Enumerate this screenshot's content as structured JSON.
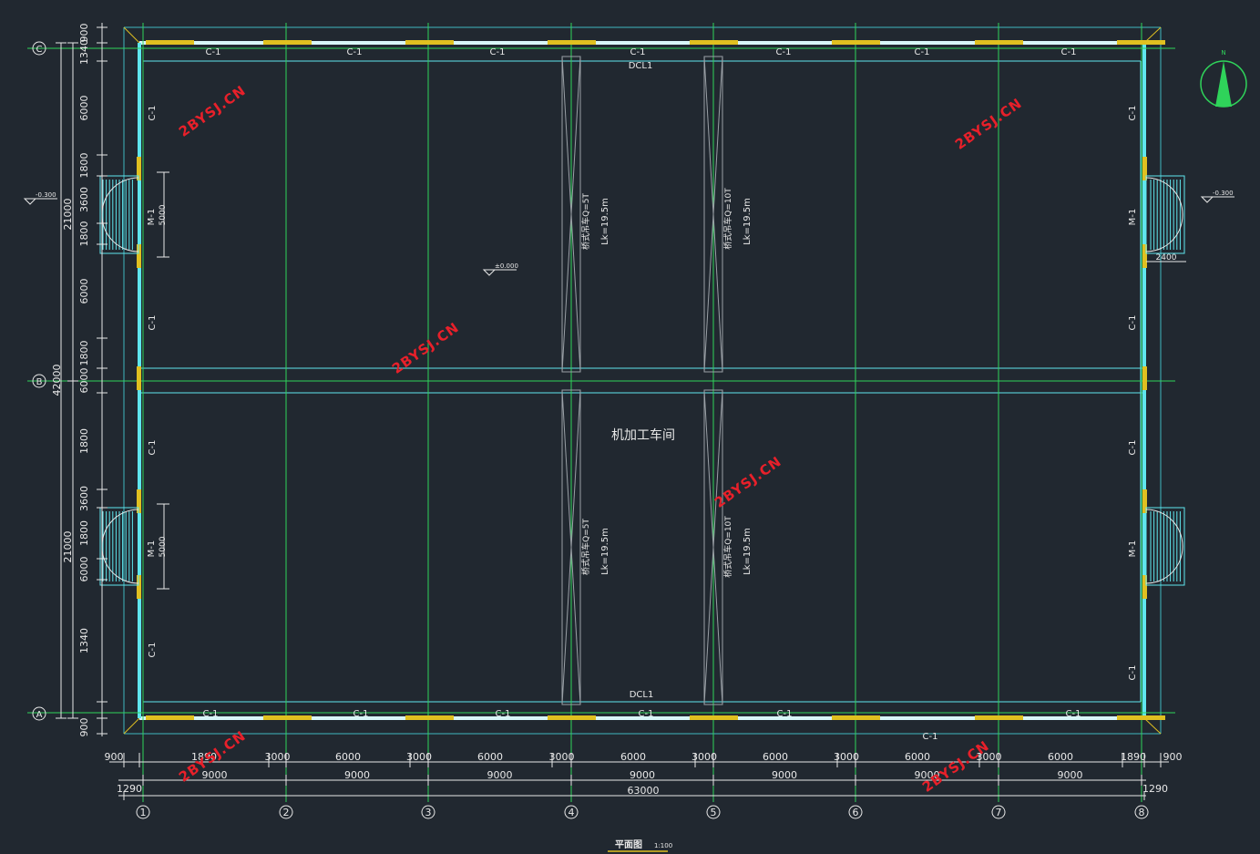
{
  "drawing": {
    "title": "平面图",
    "scale": "1:100",
    "room_name": "机加工车间",
    "elevation_inside": "±0.000",
    "elevation_outside": "-0.300"
  },
  "grid": {
    "columns": [
      "1",
      "2",
      "3",
      "4",
      "5",
      "6",
      "7",
      "8"
    ],
    "rows": [
      "A",
      "B",
      "C"
    ]
  },
  "labels": {
    "window": "C-1",
    "door": "M-1",
    "beam": "DCL1",
    "door_width": "5000",
    "ramp_width": "2400",
    "crane_5t": "桥式吊车Q=5T",
    "crane_10t": "桥式吊车Q=10T",
    "span": "Lk=19.5m"
  },
  "dims_bottom": {
    "row1": [
      "900",
      "1890",
      "3000",
      "6000",
      "3000",
      "6000",
      "3000",
      "6000",
      "3000",
      "6000",
      "3000",
      "6000",
      "3000",
      "6000",
      "1890",
      "900"
    ],
    "row2": [
      "9000",
      "9000",
      "9000",
      "9000",
      "9000",
      "9000",
      "9000"
    ],
    "row2_edge": "1290",
    "total": "63000"
  },
  "dims_left": {
    "row1": [
      "900",
      "1340",
      "6000",
      "1800",
      "3600",
      "1800",
      "6000",
      "1800",
      "6000",
      "1800",
      "3600",
      "1800",
      "6000",
      "1340",
      "900"
    ],
    "row2": [
      "21000",
      "21000"
    ],
    "total": "42000"
  },
  "watermark": "2BYSJ.CN",
  "north_label": "N",
  "colors": {
    "background": "#212830",
    "grid": "#2fd35a",
    "wall": "#5fe6ee",
    "window": "#e0c020",
    "text": "#e8e8e8",
    "watermark": "#e8202a"
  }
}
